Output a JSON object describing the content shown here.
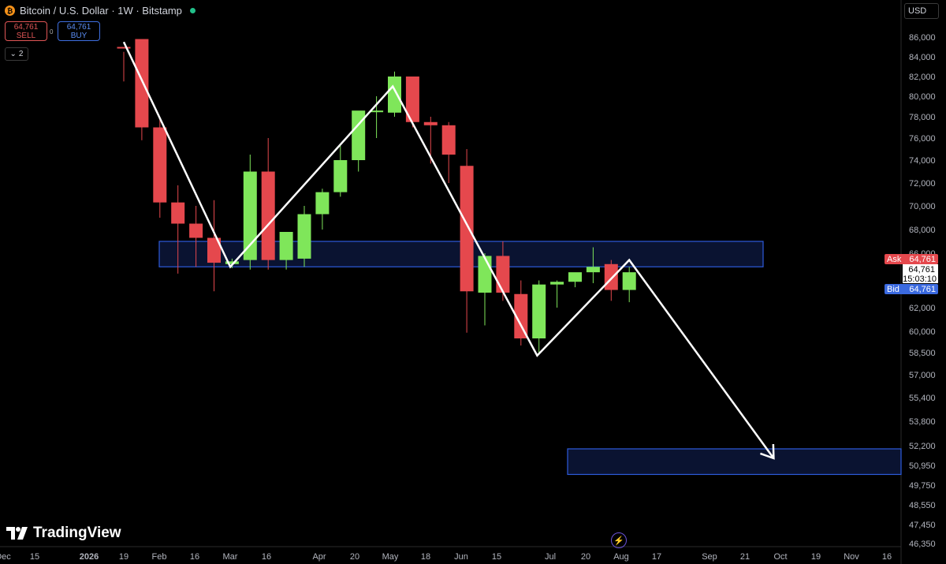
{
  "header": {
    "symbol_title": "Bitcoin / U.S. Dollar · 1W · Bitstamp",
    "sell_price": "64,761",
    "sell_label": "SELL",
    "buy_price": "64,761",
    "buy_label": "BUY",
    "spread": "0",
    "indicator_count": "2",
    "currency": "USD"
  },
  "branding": {
    "logo_text": "TradingView"
  },
  "colors": {
    "up": "#7fe65a",
    "down": "#e5484d",
    "zone": "#2d5bdb",
    "ask": "#e5484d",
    "bid": "#3b6ae0"
  },
  "chart_data": {
    "type": "candlestick",
    "y_ticks": [
      "86,000",
      "84,000",
      "82,000",
      "80,000",
      "78,000",
      "76,000",
      "74,000",
      "72,000",
      "70,000",
      "68,000",
      "66,000",
      "62,000",
      "60,000",
      "58,500",
      "57,000",
      "55,400",
      "53,800",
      "52,200",
      "50,950",
      "49,750",
      "48,550",
      "47,450",
      "46,350"
    ],
    "x_ticks": [
      "Dec",
      "15",
      "2026",
      "19",
      "Feb",
      "16",
      "Mar",
      "16",
      "Apr",
      "20",
      "May",
      "18",
      "Jun",
      "15",
      "Jul",
      "20",
      "Aug",
      "17",
      "Sep",
      "21",
      "Oct",
      "19",
      "Nov",
      "16"
    ],
    "ask": {
      "label": "Ask",
      "value": "64,761"
    },
    "last": {
      "value": "64,761",
      "countdown": "15:03:10"
    },
    "bid": {
      "label": "Bid",
      "value": "64,761"
    },
    "candles": [
      {
        "o": 87000,
        "h": 90500,
        "l": 84500,
        "c": 86200
      },
      {
        "o": 86200,
        "h": 86800,
        "l": 75800,
        "c": 77000
      },
      {
        "o": 77000,
        "h": 78000,
        "l": 69000,
        "c": 70300
      },
      {
        "o": 70300,
        "h": 71800,
        "l": 64500,
        "c": 68500
      },
      {
        "o": 68500,
        "h": 70000,
        "l": 65000,
        "c": 67300
      },
      {
        "o": 67300,
        "h": 70500,
        "l": 63200,
        "c": 65300
      },
      {
        "o": 65200,
        "h": 65600,
        "l": 64900,
        "c": 65400
      },
      {
        "o": 65500,
        "h": 74500,
        "l": 64800,
        "c": 73000
      },
      {
        "o": 73000,
        "h": 76000,
        "l": 64800,
        "c": 65500
      },
      {
        "o": 65500,
        "h": 67800,
        "l": 64800,
        "c": 67800
      },
      {
        "o": 65600,
        "h": 70000,
        "l": 65000,
        "c": 69300
      },
      {
        "o": 69300,
        "h": 71500,
        "l": 68000,
        "c": 71200
      },
      {
        "o": 71200,
        "h": 75300,
        "l": 70800,
        "c": 74000
      },
      {
        "o": 74000,
        "h": 78300,
        "l": 73000,
        "c": 78600
      },
      {
        "o": 78500,
        "h": 80000,
        "l": 76000,
        "c": 78600
      },
      {
        "o": 78400,
        "h": 82500,
        "l": 78000,
        "c": 82000
      },
      {
        "o": 82000,
        "h": 82000,
        "l": 77000,
        "c": 77500
      },
      {
        "o": 77500,
        "h": 78000,
        "l": 73700,
        "c": 77200
      },
      {
        "o": 77200,
        "h": 77500,
        "l": 72000,
        "c": 74500
      },
      {
        "o": 73500,
        "h": 75000,
        "l": 59900,
        "c": 63200
      },
      {
        "o": 63100,
        "h": 66000,
        "l": 60500,
        "c": 65800
      },
      {
        "o": 65800,
        "h": 67000,
        "l": 62500,
        "c": 63100
      },
      {
        "o": 63000,
        "h": 64000,
        "l": 59000,
        "c": 59500
      },
      {
        "o": 59500,
        "h": 64000,
        "l": 58500,
        "c": 63700
      },
      {
        "o": 63700,
        "h": 64000,
        "l": 62000,
        "c": 63900
      },
      {
        "o": 63900,
        "h": 64500,
        "l": 63500,
        "c": 64600
      },
      {
        "o": 64600,
        "h": 66500,
        "l": 63800,
        "c": 65000
      },
      {
        "o": 65200,
        "h": 65500,
        "l": 62500,
        "c": 63300
      },
      {
        "o": 63300,
        "h": 65000,
        "l": 62400,
        "c": 64600
      }
    ],
    "zones": [
      {
        "top": 67000,
        "bottom": 65000
      },
      {
        "top": 52000,
        "bottom": 50400
      }
    ],
    "path": [
      {
        "c": 0,
        "y": 86500
      },
      {
        "c": 5.9,
        "y": 65000
      },
      {
        "c": 14.9,
        "y": 81000
      },
      {
        "c": 22.9,
        "y": 58300
      },
      {
        "c": 28,
        "y": 65500
      },
      {
        "c": 36,
        "y": 51400
      }
    ]
  }
}
